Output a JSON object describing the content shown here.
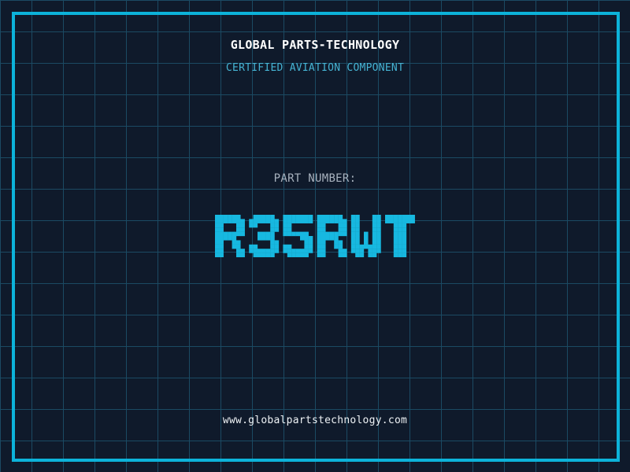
{
  "header": {
    "title": "GLOBAL PARTS-TECHNOLOGY",
    "subtitle": "CERTIFIED AVIATION COMPONENT"
  },
  "part": {
    "label": "PART NUMBER:",
    "value": "R35RWT"
  },
  "footer": {
    "url": "www.globalpartstechnology.com"
  },
  "theme": {
    "background": "#0f1a2b",
    "grid_line": "#1b4a63",
    "frame": "#0cb3da",
    "title_color": "#ffffff",
    "subtitle_color": "#46b4d4",
    "label_color": "#a8b2be",
    "value_color": "#17b8e0",
    "url_color": "#eef2f5"
  }
}
